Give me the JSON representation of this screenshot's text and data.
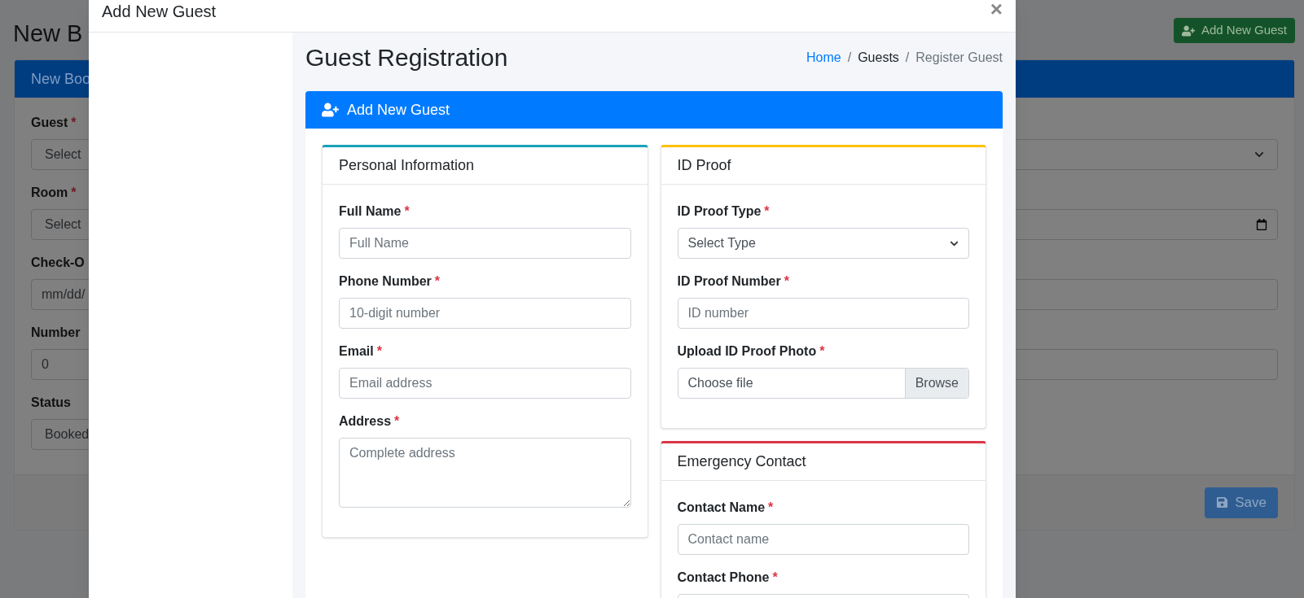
{
  "background_page": {
    "title": "New B",
    "add_button": "Add New Guest",
    "panel": {
      "header": "New Boo",
      "left_fields": [
        {
          "label": "Guest",
          "mark": "*",
          "kind": "select",
          "value": "Select"
        },
        {
          "label": "Room",
          "mark": "*",
          "kind": "select",
          "value": "Select"
        },
        {
          "label": "Check-O",
          "kind": "date",
          "value": "mm/dd/"
        },
        {
          "label": "Number",
          "kind": "input",
          "value": "0"
        },
        {
          "label": "Status",
          "kind": "select",
          "value": "Booked"
        }
      ],
      "right_fields": [
        {
          "kind": "select"
        },
        {
          "kind": "date"
        },
        {
          "kind": "input"
        },
        {
          "kind": "input"
        }
      ],
      "save_button": "Save"
    }
  },
  "modal": {
    "title": "Add New Guest",
    "close": "×",
    "page_title": "Guest Registration",
    "breadcrumb": [
      {
        "label": "Home",
        "kind": "link"
      },
      {
        "label": "Guests",
        "kind": "plain",
        "separator": "/"
      },
      {
        "label": "Register Guest",
        "kind": "current",
        "separator": "/"
      }
    ],
    "card_title": "Add New Guest",
    "columns": [
      [
        {
          "title": "Personal Information",
          "color": "#17a2b8",
          "fields": [
            {
              "label": "Full Name",
              "mark": "*",
              "kind": "text",
              "placeholder": "Full Name"
            },
            {
              "label": "Phone Number",
              "mark": "*",
              "kind": "text",
              "placeholder": "10-digit number"
            },
            {
              "label": "Email",
              "mark": "*",
              "kind": "text",
              "placeholder": "Email address"
            },
            {
              "label": "Address",
              "mark": "*",
              "kind": "textarea",
              "placeholder": "Complete address"
            }
          ]
        }
      ],
      [
        {
          "title": "ID Proof",
          "color": "#ffc107",
          "fields": [
            {
              "label": "ID Proof Type",
              "mark": "*",
              "kind": "select",
              "value": "Select Type"
            },
            {
              "label": "ID Proof Number",
              "mark": "*",
              "kind": "text",
              "placeholder": "ID number"
            },
            {
              "label": "Upload ID Proof Photo",
              "mark": "*",
              "kind": "file",
              "value": "Choose file",
              "button": "Browse"
            }
          ]
        },
        {
          "title": "Emergency Contact",
          "color": "#dc3545",
          "fields": [
            {
              "label": "Contact Name",
              "mark": "*",
              "kind": "text",
              "placeholder": "Contact name"
            },
            {
              "label": "Contact Phone",
              "mark": "*",
              "kind": "text"
            }
          ]
        }
      ]
    ]
  }
}
